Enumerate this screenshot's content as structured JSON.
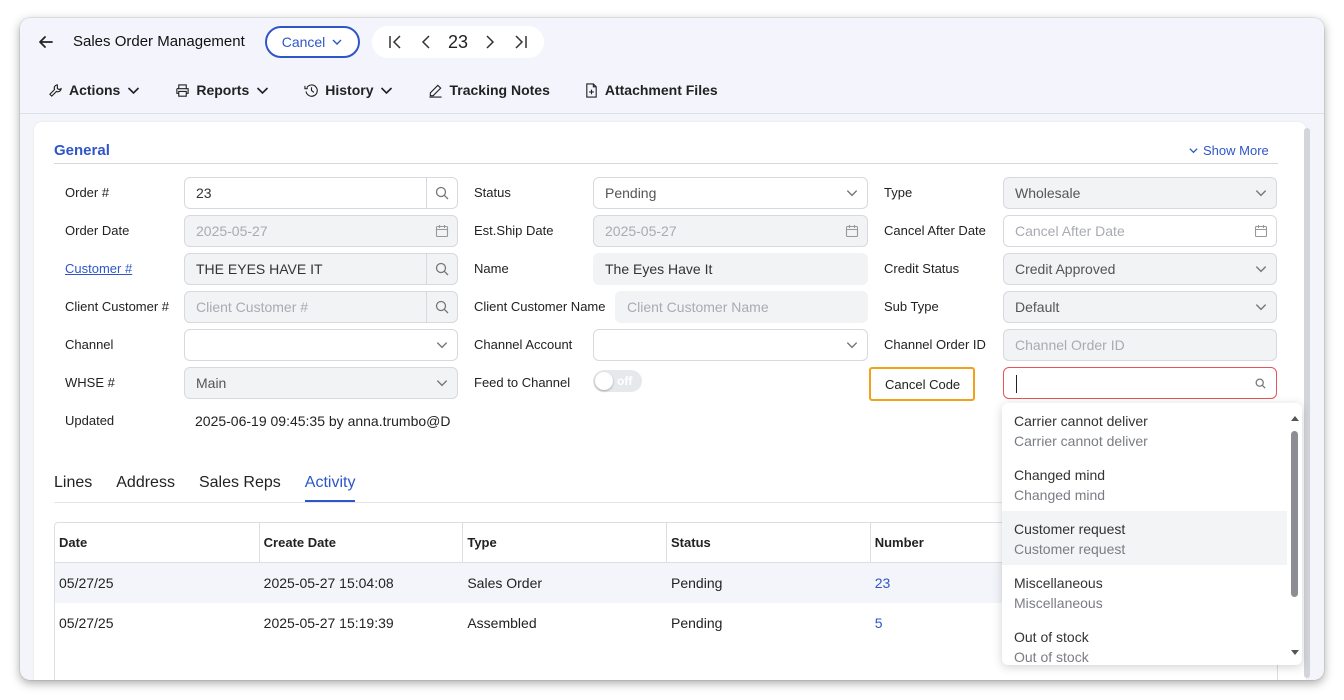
{
  "header": {
    "title": "Sales Order Management",
    "status_button": "Cancel",
    "current_record": "23"
  },
  "toolbar": {
    "actions": "Actions",
    "reports": "Reports",
    "history": "History",
    "tracking_notes": "Tracking Notes",
    "attachment_files": "Attachment Files"
  },
  "general": {
    "title": "General",
    "show_more": "Show More",
    "labels": {
      "order_no": "Order #",
      "order_date": "Order Date",
      "customer_no": "Customer #",
      "client_customer_no": "Client Customer #",
      "channel": "Channel",
      "whse_no": "WHSE #",
      "updated": "Updated",
      "status": "Status",
      "est_ship_date": "Est.Ship Date",
      "name": "Name",
      "client_customer_name": "Client Customer Name",
      "channel_account": "Channel Account",
      "feed_to_channel": "Feed to Channel",
      "type": "Type",
      "cancel_after_date": "Cancel After Date",
      "credit_status": "Credit Status",
      "sub_type": "Sub Type",
      "channel_order_id": "Channel Order ID",
      "cancel_code": "Cancel Code"
    },
    "values": {
      "order_no": "23",
      "order_date": "2025-05-27",
      "customer_no": "THE EYES HAVE IT",
      "client_customer_no_placeholder": "Client Customer #",
      "channel": "",
      "whse_no": "Main",
      "updated": "2025-06-19 09:45:35 by anna.trumbo@D",
      "status": "Pending",
      "est_ship_date": "2025-05-27",
      "name": "The Eyes Have It",
      "client_customer_name_placeholder": "Client Customer Name",
      "channel_account": "",
      "feed_to_channel": "off",
      "type": "Wholesale",
      "cancel_after_date_placeholder": "Cancel After Date",
      "credit_status": "Credit Approved",
      "sub_type": "Default",
      "channel_order_id_placeholder": "Channel Order ID",
      "cancel_code": ""
    }
  },
  "tabs": [
    "Lines",
    "Address",
    "Sales Reps",
    "Activity"
  ],
  "activity_table": {
    "columns": [
      "Date",
      "Create Date",
      "Type",
      "Status",
      "Number"
    ],
    "rows": [
      [
        "05/27/25",
        "2025-05-27 15:04:08",
        "Sales Order",
        "Pending",
        "23"
      ],
      [
        "05/27/25",
        "2025-05-27 15:19:39",
        "Assembled",
        "Pending",
        "5"
      ]
    ]
  },
  "cancel_code_options": [
    {
      "code": "Carrier cannot deliver",
      "desc": "Carrier cannot deliver"
    },
    {
      "code": "Changed mind",
      "desc": "Changed mind"
    },
    {
      "code": "Customer request",
      "desc": "Customer request"
    },
    {
      "code": "Miscellaneous",
      "desc": "Miscellaneous"
    },
    {
      "code": "Out of stock",
      "desc": "Out of stock"
    }
  ],
  "colors": {
    "accent": "#2f56c9",
    "highlight": "#f0a21c",
    "error": "#e55555"
  }
}
